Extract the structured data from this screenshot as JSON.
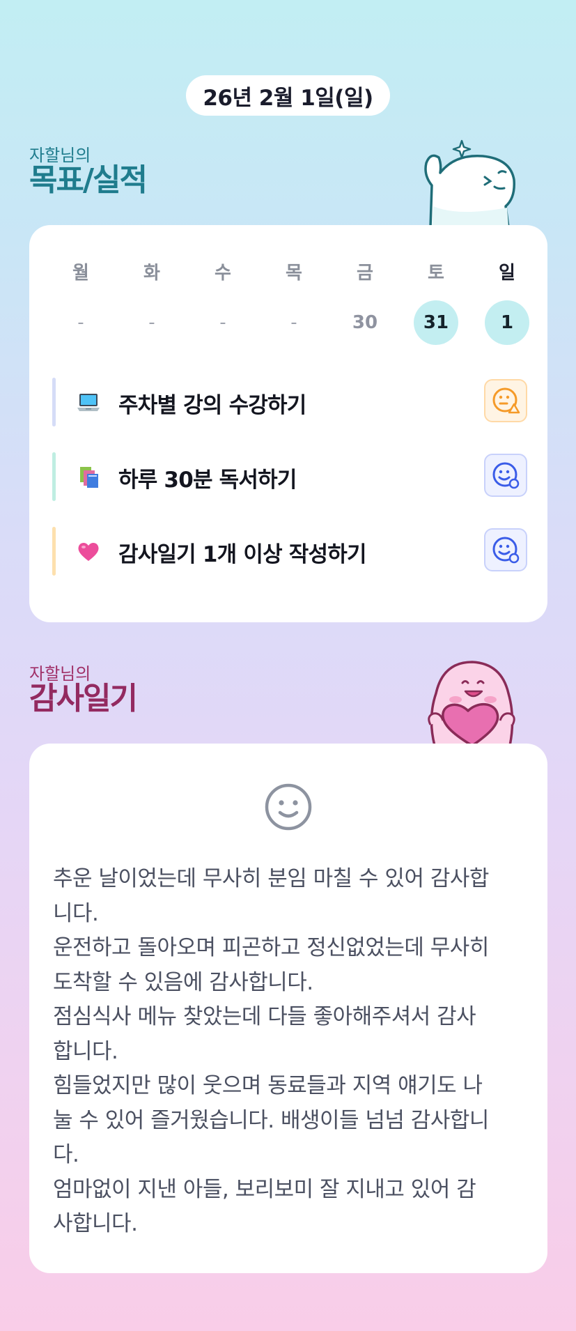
{
  "date_label": "26년 2월 1일(일)",
  "goal_section": {
    "subtitle": "자할님의",
    "title": "목표/실적"
  },
  "week": [
    {
      "day": "월",
      "num": "-",
      "state": "empty"
    },
    {
      "day": "화",
      "num": "-",
      "state": "empty"
    },
    {
      "day": "수",
      "num": "-",
      "state": "empty"
    },
    {
      "day": "목",
      "num": "-",
      "state": "empty"
    },
    {
      "day": "금",
      "num": "30",
      "state": "plain"
    },
    {
      "day": "토",
      "num": "31",
      "state": "active"
    },
    {
      "day": "일",
      "num": "1",
      "state": "active-today"
    }
  ],
  "goals": [
    {
      "emoji": "laptop-emoji",
      "text": "주차별 강의 수강하기",
      "bar_color": "#d5dcf7",
      "status": "in-progress-face-icon"
    },
    {
      "emoji": "books-emoji",
      "text": "하루 30분 독서하기",
      "bar_color": "#bfeee2",
      "status": "done-face-icon"
    },
    {
      "emoji": "heart-emoji",
      "text": "감사일기 1개 이상 작성하기",
      "bar_color": "#fde0ae",
      "status": "done-face-icon"
    }
  ],
  "gratitude_section": {
    "subtitle": "자할님의",
    "title": "감사일기"
  },
  "diary_lines": [
    "추운 날이었는데 무사히 분임 마칠 수 있어 감사합",
    "니다.",
    "운전하고 돌아오며 피곤하고 정신없었는데 무사히",
    "도착할 수 있음에 감사합니다.",
    "점심식사 메뉴 찾았는데 다들 좋아해주셔서 감사",
    "합니다.",
    "힘들었지만 많이 웃으며 동료들과 지역 얘기도 나",
    "눌 수 있어 즐거웠습니다. 배생이들 넘넘 감사합니",
    "다.",
    "엄마없이 지낸 아들, 보리보미 잘 지내고 있어 감",
    "사합니다."
  ],
  "colors": {
    "goal_title": "#1f7c8d",
    "gratitude_title": "#932a60",
    "active_day": "#c3eef1",
    "status_orange": "#f59a28",
    "status_blue": "#3a5ce8"
  }
}
